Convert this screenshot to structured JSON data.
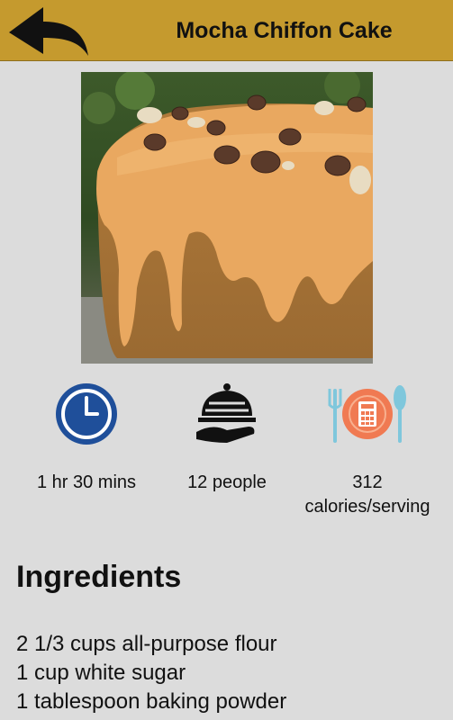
{
  "header": {
    "title": "Mocha Chiffon Cake",
    "color": "#c59a2e"
  },
  "stats": {
    "time": {
      "icon": "clock-icon",
      "label": "1 hr 30 mins"
    },
    "servings": {
      "icon": "serving-cloche-icon",
      "label": "12 people"
    },
    "calories": {
      "icon": "calculator-plate-icon",
      "line1": "312",
      "line2": "calories/serving"
    }
  },
  "ingredients": {
    "title": "Ingredients",
    "items": [
      "2 1/3 cups all-purpose flour",
      "1 cup white sugar",
      "1 tablespoon baking powder"
    ]
  }
}
